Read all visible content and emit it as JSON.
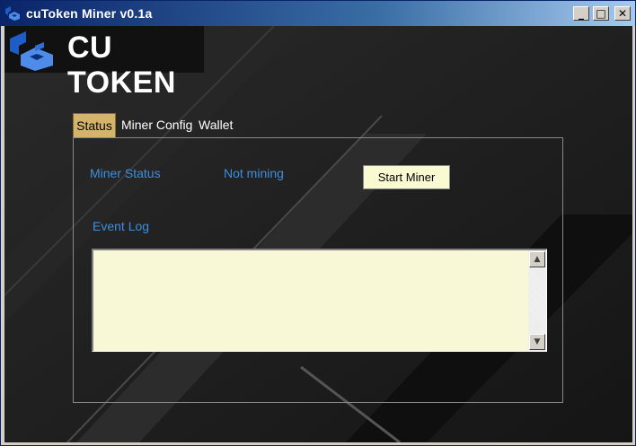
{
  "window": {
    "title": "cuToken Miner v0.1a",
    "icon": "cutoken-logo-icon",
    "controls": {
      "minimize": "_",
      "maximize": "□",
      "close": "✕"
    }
  },
  "logo": {
    "text": "CU TOKEN",
    "icon": "cutoken-logo-icon"
  },
  "tabs": [
    {
      "label": "Status",
      "active": true
    },
    {
      "label": "Miner Config",
      "active": false
    },
    {
      "label": "Wallet",
      "active": false
    }
  ],
  "status": {
    "miner_status_label": "Miner Status",
    "miner_status_value": "Not mining",
    "start_button": "Start Miner",
    "event_log_label": "Event Log",
    "event_log_content": ""
  },
  "scrollbar": {
    "up_icon": "▲",
    "down_icon": "▼"
  },
  "colors": {
    "accent_text": "#3d8ee0",
    "active_tab": "#d4b36a",
    "button_bg": "#fafad2",
    "log_bg": "#f8f8d6"
  }
}
